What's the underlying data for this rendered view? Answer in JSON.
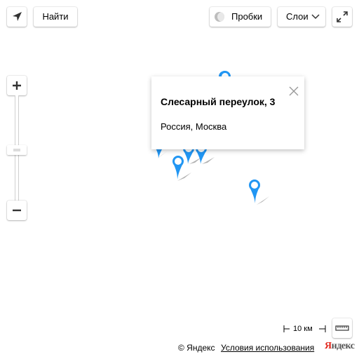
{
  "toolbar": {
    "search_label": "Найти",
    "traffic_label": "Пробки",
    "layers_label": "Слои"
  },
  "balloon": {
    "title": "Слесарный переулок, 3",
    "subtitle": "Россия, Москва"
  },
  "scale": {
    "label": "10 км"
  },
  "footer": {
    "copyright": "© Яндекс",
    "terms_link": "Условия использования",
    "brand_first": "Я",
    "brand_rest": "ндекс"
  },
  "colors": {
    "pin": "#2196f3",
    "brand_red": "#e2261c"
  },
  "icons": [
    "geolocation-icon",
    "traffic-icon",
    "chevron-down-icon",
    "fullscreen-icon",
    "zoom-in-icon",
    "zoom-out-icon",
    "close-icon",
    "ruler-icon",
    "map-pin-icon"
  ]
}
